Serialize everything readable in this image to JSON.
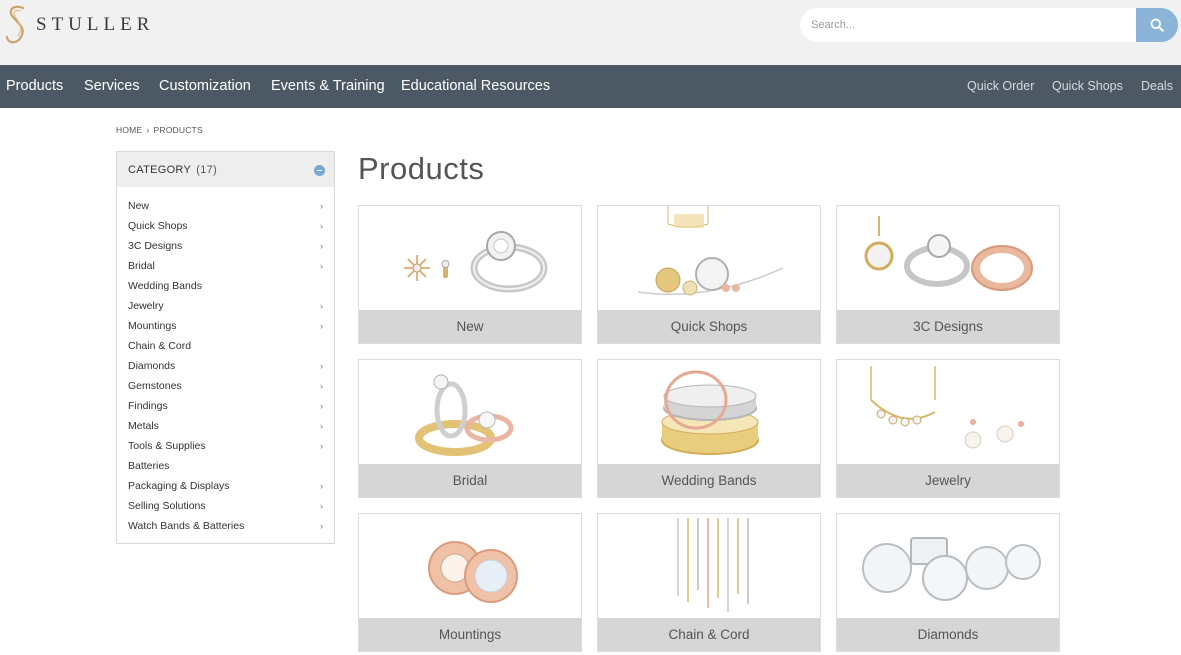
{
  "brand": {
    "name": "STULLER"
  },
  "search": {
    "placeholder": "Search..."
  },
  "nav": {
    "items": [
      "Products",
      "Services",
      "Customization",
      "Events & Training",
      "Educational Resources"
    ],
    "utility": [
      "Quick Order",
      "Quick Shops",
      "Deals"
    ]
  },
  "breadcrumb": {
    "home": "HOME",
    "current": "PRODUCTS"
  },
  "sidebar": {
    "title": "CATEGORY",
    "count": "(17)",
    "categories": [
      "New",
      "Quick Shops",
      "3C Designs",
      "Bridal",
      "Wedding Bands",
      "Jewelry",
      "Mountings",
      "Chain & Cord",
      "Diamonds",
      "Gemstones",
      "Findings",
      "Metals",
      "Tools & Supplies",
      "Batteries",
      "Packaging & Displays",
      "Selling Solutions",
      "Watch Bands & Batteries"
    ]
  },
  "main": {
    "title": "Products",
    "tiles": [
      "New",
      "Quick Shops",
      "3C Designs",
      "Bridal",
      "Wedding Bands",
      "Jewelry",
      "Mountings",
      "Chain & Cord",
      "Diamonds"
    ]
  },
  "colors": {
    "nav_bg": "#4c5863",
    "header_bg": "#f1f1f1",
    "search_button": "#8cb4d8",
    "tile_label_bg": "#d6d6d6"
  }
}
